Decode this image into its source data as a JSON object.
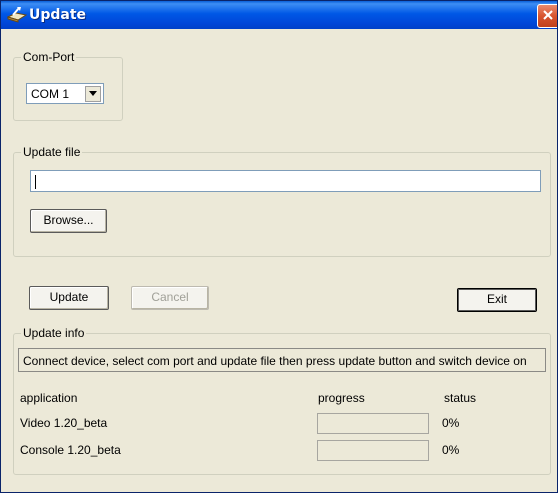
{
  "window": {
    "title": "Update"
  },
  "com_port": {
    "group_label": "Com-Port",
    "selected": "COM 1"
  },
  "update_file": {
    "group_label": "Update file",
    "path_value": "",
    "browse_label": "Browse..."
  },
  "actions": {
    "update_label": "Update",
    "cancel_label": "Cancel",
    "exit_label": "Exit"
  },
  "update_info": {
    "group_label": "Update info",
    "message": "Connect device, select com port and update file then press update button and switch device on",
    "columns": {
      "application": "application",
      "progress": "progress",
      "status": "status"
    },
    "rows": [
      {
        "application": "Video  1.20_beta",
        "progress": 0,
        "status": "0%"
      },
      {
        "application": "Console  1.20_beta",
        "progress": 0,
        "status": "0%"
      }
    ]
  },
  "colors": {
    "titlebar": "#0058e6",
    "dialog_background": "#ece9d8",
    "close_button": "#d8552f"
  },
  "icons": {
    "title_icon": "update-app-icon",
    "close_icon": "close-x",
    "dropdown_icon": "chevron-down"
  }
}
